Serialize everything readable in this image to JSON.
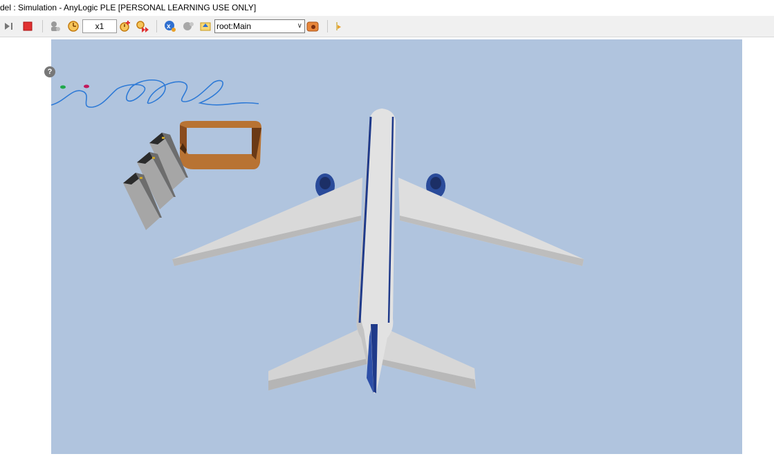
{
  "window": {
    "title": "del : Simulation - AnyLogic PLE [PERSONAL LEARNING USE ONLY]"
  },
  "toolbar": {
    "run_step_icon": "step-icon",
    "stop_icon": "stop-icon",
    "speed_value": "x1",
    "navigation_select": {
      "selected": "root:Main"
    },
    "icons": [
      "step-icon",
      "stop-icon",
      "agent-icon",
      "slower-icon",
      "faster-icon",
      "virtual-time-icon",
      "experiment-icon",
      "pause-agent-icon",
      "navigate-up-icon",
      "navigate-icon",
      "developer-panel-icon"
    ]
  },
  "canvas": {
    "background_color": "#b0c4de",
    "objects": [
      "airplane-3d",
      "baggage-loop",
      "check-in-counters",
      "wavy-path"
    ]
  },
  "colors": {
    "accent_red": "#e03131",
    "accent_orange": "#e8863a",
    "fuselage_stripe": "#1f3a8a",
    "baggage_brown": "#b87333"
  }
}
